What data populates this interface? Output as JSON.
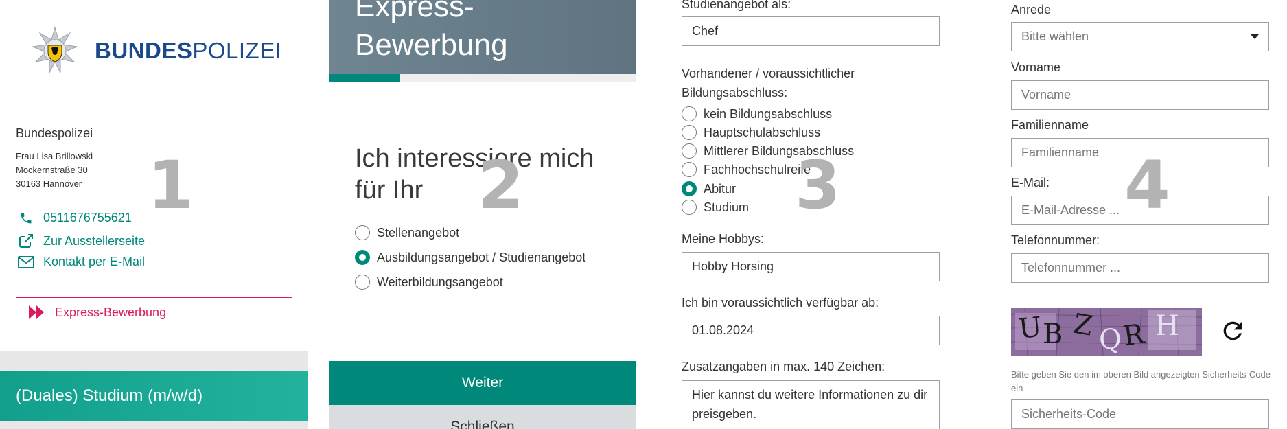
{
  "panel1": {
    "logo_text_bold": "BUNDES",
    "logo_text_light": "POLIZEI",
    "org_name": "Bundespolizei",
    "address": {
      "contact": "Frau Lisa Brillowski",
      "street": "Möckernstraße 30",
      "city": "30163 Hannover"
    },
    "phone": "0511676755621",
    "exhibitor_link": "Zur Ausstellerseite",
    "email_link": "Kontakt per E-Mail",
    "express_button": "Express-Bewerbung",
    "offer_title": "(Duales) Studium (m/w/d)",
    "step": "1",
    "accent_color": "#00897b",
    "express_color": "#d81b60"
  },
  "panel2": {
    "header_title": "Express-Bewerbung",
    "progress_percent": 23,
    "question": "Ich interessiere mich für Ihr",
    "options": [
      {
        "label": "Stellenangebot",
        "checked": false
      },
      {
        "label": "Ausbildungsangebot / Studienangebot",
        "checked": true
      },
      {
        "label": "Weiterbildungsangebot",
        "checked": false
      }
    ],
    "next_button": "Weiter",
    "close_button": "Schließen",
    "step": "2"
  },
  "panel3": {
    "label_offer": "Studienangebot als:",
    "offer_value": "Chef",
    "label_degree": "Vorhandener / voraussichtlicher Bildungsabschluss:",
    "degree_options": [
      {
        "label": "kein Bildungsabschluss",
        "checked": false
      },
      {
        "label": "Hauptschulabschluss",
        "checked": false
      },
      {
        "label": "Mittlerer Bildungsabschluss",
        "checked": false
      },
      {
        "label": "Fachhochschulreife",
        "checked": false
      },
      {
        "label": "Abitur",
        "checked": true
      },
      {
        "label": "Studium",
        "checked": false
      }
    ],
    "label_hobbies": "Meine Hobbys:",
    "hobbies_value": "Hobby Horsing",
    "label_available": "Ich bin voraussichtlich verfügbar ab:",
    "available_value": "01.08.2024",
    "label_extra": "Zusatzangaben in max. 140 Zeichen:",
    "extra_text_1": "Hier kannst du weitere Informationen zu dir ",
    "extra_text_underlined": "preisgeben",
    "extra_text_2": ".",
    "step": "3"
  },
  "panel4": {
    "label_salutation": "Anrede",
    "salutation_placeholder": "Bitte wählen",
    "label_firstname": "Vorname",
    "firstname_placeholder": "Vorname",
    "label_lastname": "Familienname",
    "lastname_placeholder": "Familienname",
    "label_email": "E-Mail:",
    "email_placeholder": "E-Mail-Adresse ...",
    "label_phone": "Telefonnummer:",
    "phone_placeholder": "Telefonnummer ...",
    "captcha_text": "UBZQRH",
    "captcha_hint": "Bitte geben Sie den im oberen Bild angezeigten Sicherheits-Code ein",
    "security_placeholder": "Sicherheits-Code",
    "step": "4"
  }
}
